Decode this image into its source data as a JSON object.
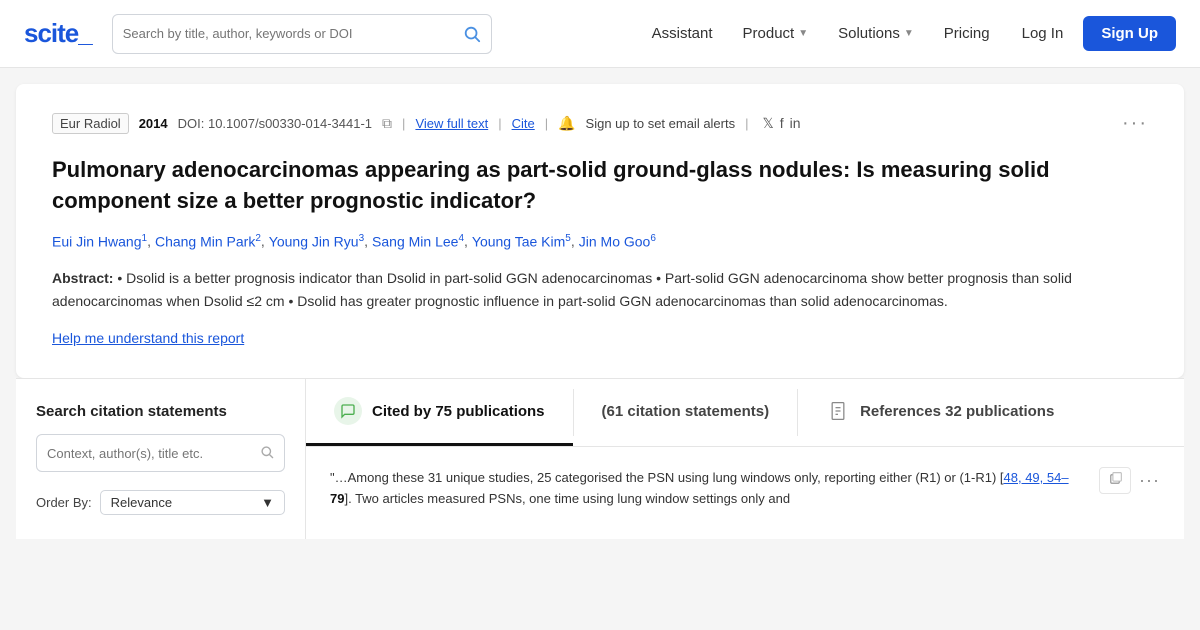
{
  "logo": {
    "text": "scite_"
  },
  "header": {
    "search_placeholder": "Search by title, author, keywords or DOI",
    "nav": {
      "assistant": "Assistant",
      "product": "Product",
      "solutions": "Solutions",
      "pricing": "Pricing",
      "login": "Log In",
      "signup": "Sign Up"
    }
  },
  "paper": {
    "journal": "Eur Radiol",
    "year": "2014",
    "doi": "DOI: 10.1007/s00330-014-3441-1",
    "view_full_text": "View full text",
    "cite": "Cite",
    "alert_text": "Sign up to set email alerts",
    "title": "Pulmonary adenocarcinomas appearing as part-solid ground-glass nodules: Is measuring solid component size a better prognostic indicator?",
    "authors": [
      {
        "name": "Eui Jin Hwang",
        "sup": "1"
      },
      {
        "name": "Chang Min Park",
        "sup": "2"
      },
      {
        "name": "Young Jin Ryu",
        "sup": "3"
      },
      {
        "name": "Sang Min Lee",
        "sup": "4"
      },
      {
        "name": "Young Tae Kim",
        "sup": "5"
      },
      {
        "name": "Jin Mo Goo",
        "sup": "6"
      }
    ],
    "abstract_label": "Abstract:",
    "abstract_text": "Dsolid is a better prognosis indicator than Dsolid in part-solid GGN adenocarcinomas • Part-solid GGN adenocarcinoma show better prognosis than solid adenocarcinomas when Dsolid ≤2 cm • Dsolid has greater prognostic influence in part-solid GGN adenocarcinomas than solid adenocarcinomas.",
    "help_link": "Help me understand this report"
  },
  "sidebar": {
    "title": "Search citation statements",
    "search_placeholder": "Context, author(s), title etc.",
    "order_by_label": "Order By:",
    "order_by_value": "Relevance"
  },
  "tabs": [
    {
      "id": "cited-by",
      "icon_type": "bubble",
      "label": "Cited by 75 publications",
      "sub": "",
      "active": true
    },
    {
      "id": "citation-statements",
      "icon_type": "none",
      "label": "(61 citation statements)",
      "sub": "",
      "active": false
    },
    {
      "id": "references",
      "icon_type": "doc",
      "label": "References 32 publications",
      "sub": "",
      "active": false
    }
  ],
  "citation_quote": {
    "text_before": "\"…Among these 31 unique studies, 25 categorised the PSN using lung windows only, reporting either (R1) or (1-R1) [",
    "refs": "48, 49, 54–",
    "highlighted": "79",
    "text_after": "]. Two articles measured PSNs, one time using lung window settings only and"
  }
}
